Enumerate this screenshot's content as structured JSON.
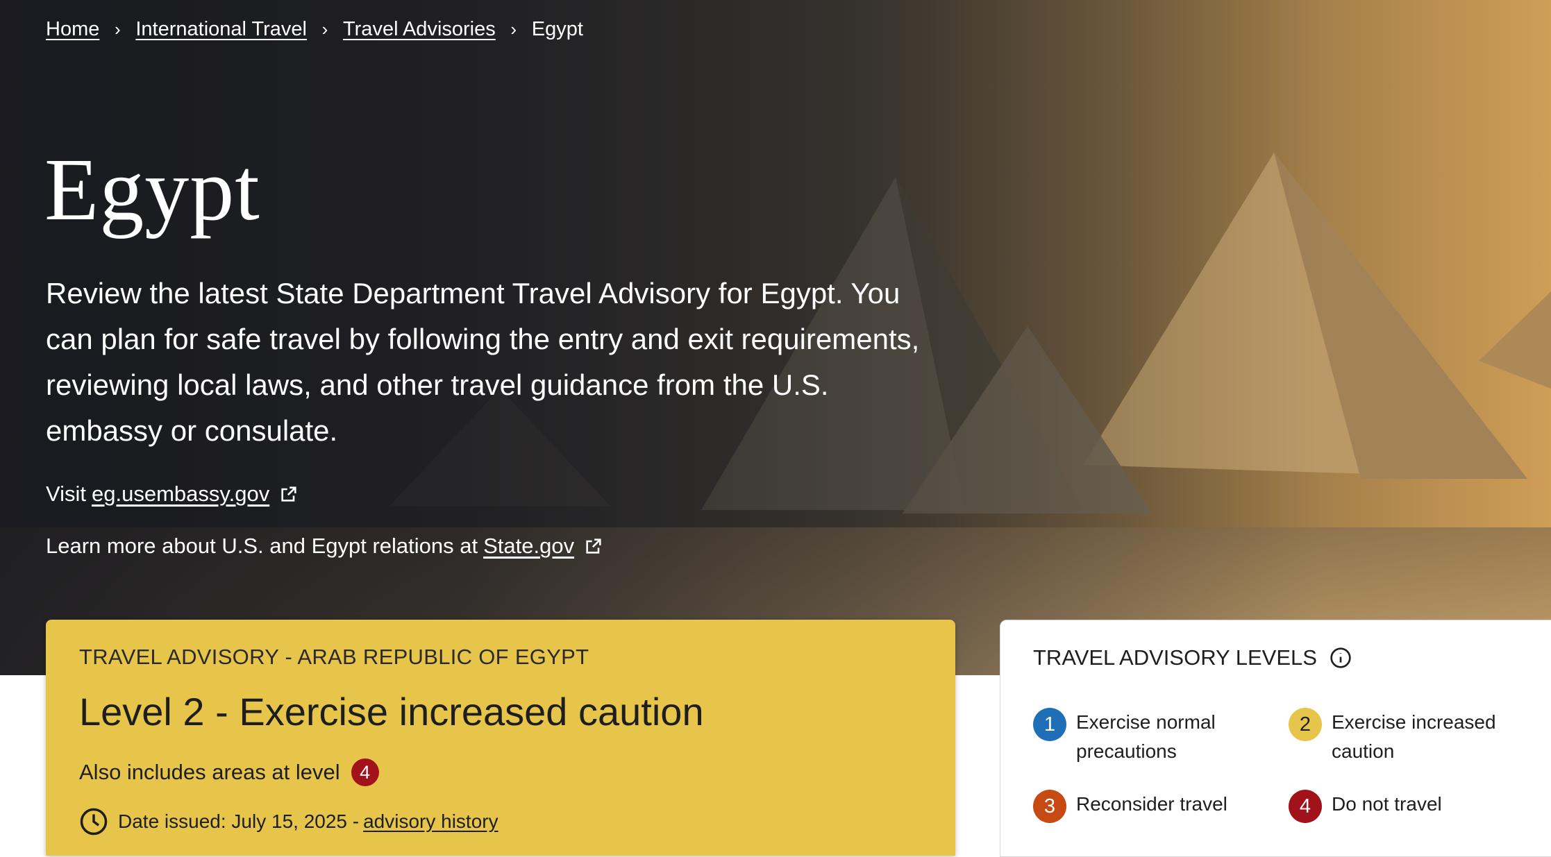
{
  "breadcrumb": {
    "items": [
      "Home",
      "International Travel",
      "Travel Advisories"
    ],
    "current": "Egypt"
  },
  "hero": {
    "title": "Egypt",
    "intro": "Review the latest State Department Travel Advisory for Egypt. You can plan for safe travel by following the entry and exit requirements, reviewing local laws, and other travel guidance from the U.S. embassy or consulate.",
    "visit_prefix": "Visit",
    "visit_link": "eg.usembassy.gov",
    "learn_prefix": "Learn more about U.S. and Egypt relations at",
    "learn_link": "State.gov"
  },
  "advisory": {
    "label": "TRAVEL ADVISORY - ARAB REPUBLIC OF EGYPT",
    "level_title": "Level 2 - Exercise increased caution",
    "also_text": "Also includes areas at level",
    "also_level": "4",
    "date_text": "Date issued: July 15, 2025 -",
    "history_link": "advisory history",
    "background_color": "#e6c54a"
  },
  "levels": {
    "heading": "TRAVEL ADVISORY LEVELS",
    "items": [
      {
        "number": "1",
        "line1": "Exercise normal",
        "line2": "precautions",
        "color": "#1f6eb8"
      },
      {
        "number": "2",
        "line1": "Exercise increased",
        "line2": "caution",
        "color": "#e6c54a"
      },
      {
        "number": "3",
        "line1": "Reconsider travel",
        "line2": "",
        "color": "#c54b12"
      },
      {
        "number": "4",
        "line1": "Do not travel",
        "line2": "",
        "color": "#a1121b"
      }
    ]
  },
  "icons": {
    "breadcrumb_separator": "chevron-right-icon",
    "external": "external-link-icon",
    "clock": "clock-icon",
    "info": "info-icon"
  }
}
